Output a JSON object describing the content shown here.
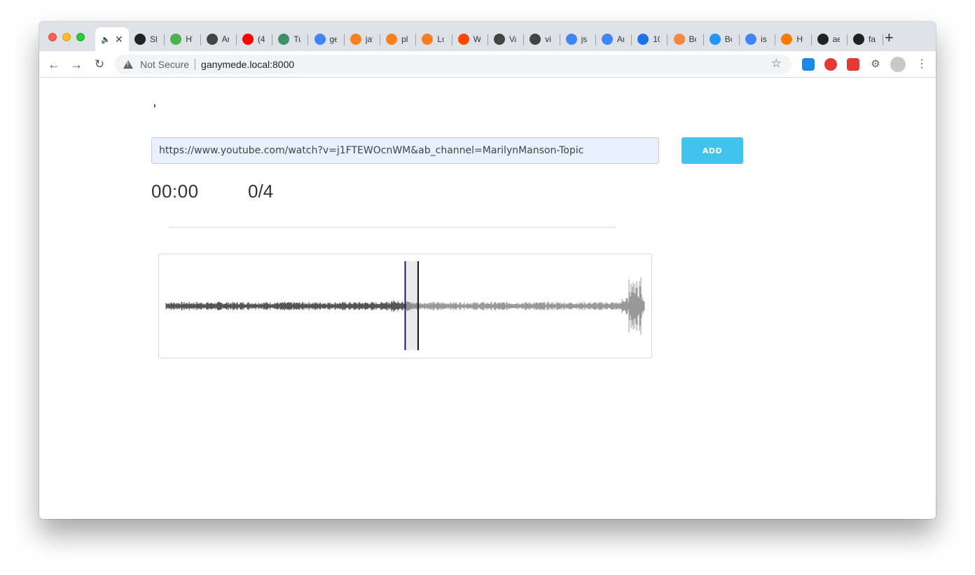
{
  "browser": {
    "active_tab_icon": "speaker-icon",
    "tabs": [
      {
        "label": "Sh",
        "icon": "s-circle-icon",
        "color": "#222222"
      },
      {
        "label": "HT",
        "icon": "w3-icon",
        "color": "#4caf50"
      },
      {
        "label": "Ar",
        "icon": "globe-icon",
        "color": "#444444"
      },
      {
        "label": "(4",
        "icon": "youtube-icon",
        "color": "#ff0000"
      },
      {
        "label": "Tu",
        "icon": "flask-icon",
        "color": "#3f8f6a"
      },
      {
        "label": "ge",
        "icon": "google-icon",
        "color": "#4285f4"
      },
      {
        "label": "jav",
        "icon": "stackoverflow-icon",
        "color": "#f48024"
      },
      {
        "label": "pl",
        "icon": "stackoverflow-icon",
        "color": "#f48024"
      },
      {
        "label": "Lo",
        "icon": "stackoverflow-icon",
        "color": "#f48024"
      },
      {
        "label": "W",
        "icon": "reddit-icon",
        "color": "#ff4500"
      },
      {
        "label": "Va",
        "icon": "globe-icon",
        "color": "#444444"
      },
      {
        "label": "vi",
        "icon": "globe-icon",
        "color": "#444444"
      },
      {
        "label": "js",
        "icon": "google-icon",
        "color": "#4285f4"
      },
      {
        "label": "Ar",
        "icon": "google-icon",
        "color": "#4285f4"
      },
      {
        "label": "10",
        "icon": "hackernoon-icon",
        "color": "#1a73e8"
      },
      {
        "label": "Bo",
        "icon": "fox-icon",
        "color": "#f0883e"
      },
      {
        "label": "Bo",
        "icon": "square-icon",
        "color": "#2196f3"
      },
      {
        "label": "is",
        "icon": "google-icon",
        "color": "#4285f4"
      },
      {
        "label": "H",
        "icon": "star-icon",
        "color": "#f57c00"
      },
      {
        "label": "ae",
        "icon": "github-icon",
        "color": "#222222"
      },
      {
        "label": "fa",
        "icon": "github-icon",
        "color": "#222222"
      }
    ],
    "new_tab": "+",
    "security_label": "Not Secure",
    "url": "ganymede.local:8000"
  },
  "page": {
    "dot": "'",
    "input_value": "https://www.youtube.com/watch?v=j1FTEWOcnWM&ab_channel=MarilynManson-Topic",
    "add_label": "ADD",
    "time": "00:00",
    "count": "0/4",
    "waveform": {
      "played_color": "#555555",
      "unplayed_color": "#999999",
      "selection_start": 0.5,
      "selection_end": 0.527
    }
  }
}
